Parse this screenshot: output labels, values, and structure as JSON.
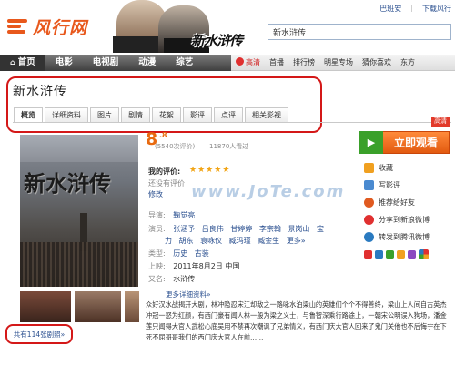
{
  "header": {
    "logo_text": "风行网",
    "banner_title": "新水浒传",
    "search_value": "新水浒传",
    "top_links": [
      "巴班安",
      "|",
      "下载风行"
    ]
  },
  "nav": {
    "main": [
      {
        "label": "首页",
        "icon": "home-icon"
      },
      {
        "label": "电影"
      },
      {
        "label": "电视剧"
      },
      {
        "label": "动漫"
      },
      {
        "label": "综艺"
      }
    ],
    "sub": [
      "高清",
      "首播",
      "排行榜",
      "明星专场",
      "猜你喜欢",
      "东方"
    ]
  },
  "movie": {
    "title": "新水浒传",
    "tabs": [
      "概览",
      "详细资料",
      "图片",
      "剧情",
      "花絮",
      "影评",
      "点评",
      "相关影视"
    ],
    "active_tab": "概览",
    "hq_tag": "高清",
    "score": "8",
    "score_decimal": ".8",
    "rating_count": "(5540次评价)",
    "play_count": "11870人看过",
    "my_rating_label": "我的评价:",
    "rating_hint": "还没有评价",
    "edit_link": "修改",
    "director_label": "导演:",
    "director": "鞠觉亮",
    "cast_label": "演员:",
    "cast_line1": [
      "张涵予",
      "吕良伟",
      "甘婷婷",
      "李宗翰",
      "景岗山",
      "宝"
    ],
    "cast_line2": [
      "力",
      "胡东",
      "袁咏仪",
      "臧玛瑾",
      "臧金生",
      "更多»"
    ],
    "type_label": "类型:",
    "types": [
      "历史",
      "古装"
    ],
    "release_label": "上映:",
    "release": "2011年8月2日  中国",
    "orig_label": "又名:",
    "orig_name": "水浒传",
    "more_detail": "更多详细资料»",
    "synopsis": "众好汉水战揭开大剧，林冲隐忍宋江却敌之一路咏水泊梁山的英雄们个个不得善终，梁山上人间自古英杰冲冠一怒为红颜，有西门豪有闻人林一般为梁之义士，与鲁智深乘行路途上，一朝宋公明误入狗场，潘金莲只闻得大官人武松心底吴用不禁再次嘲讽了兄弟情义，有西门庆大官人回来了鬼门关他也不后悔宁在下死不屈哥哥我们的西门庆大官人在前……",
    "stills_link": "共有114张剧照»",
    "watermark": "www.JoTe.com"
  },
  "sidebar": {
    "watch_label": "立即观看",
    "items": [
      {
        "label": "收藏",
        "icon": "star-collect-icon"
      },
      {
        "label": "写影评",
        "icon": "pencil-review-icon"
      },
      {
        "label": "推荐给好友",
        "icon": "recommend-icon"
      },
      {
        "label": "分享到新浪微博",
        "icon": "weibo-icon"
      },
      {
        "label": "转发到腾讯微博",
        "icon": "tencent-weibo-icon"
      }
    ]
  },
  "colors": {
    "accent": "#e8581c",
    "link": "#2a4f8f",
    "highlight_border": "#d41818",
    "score": "#e86a10",
    "watch_button": "#e25a10"
  }
}
